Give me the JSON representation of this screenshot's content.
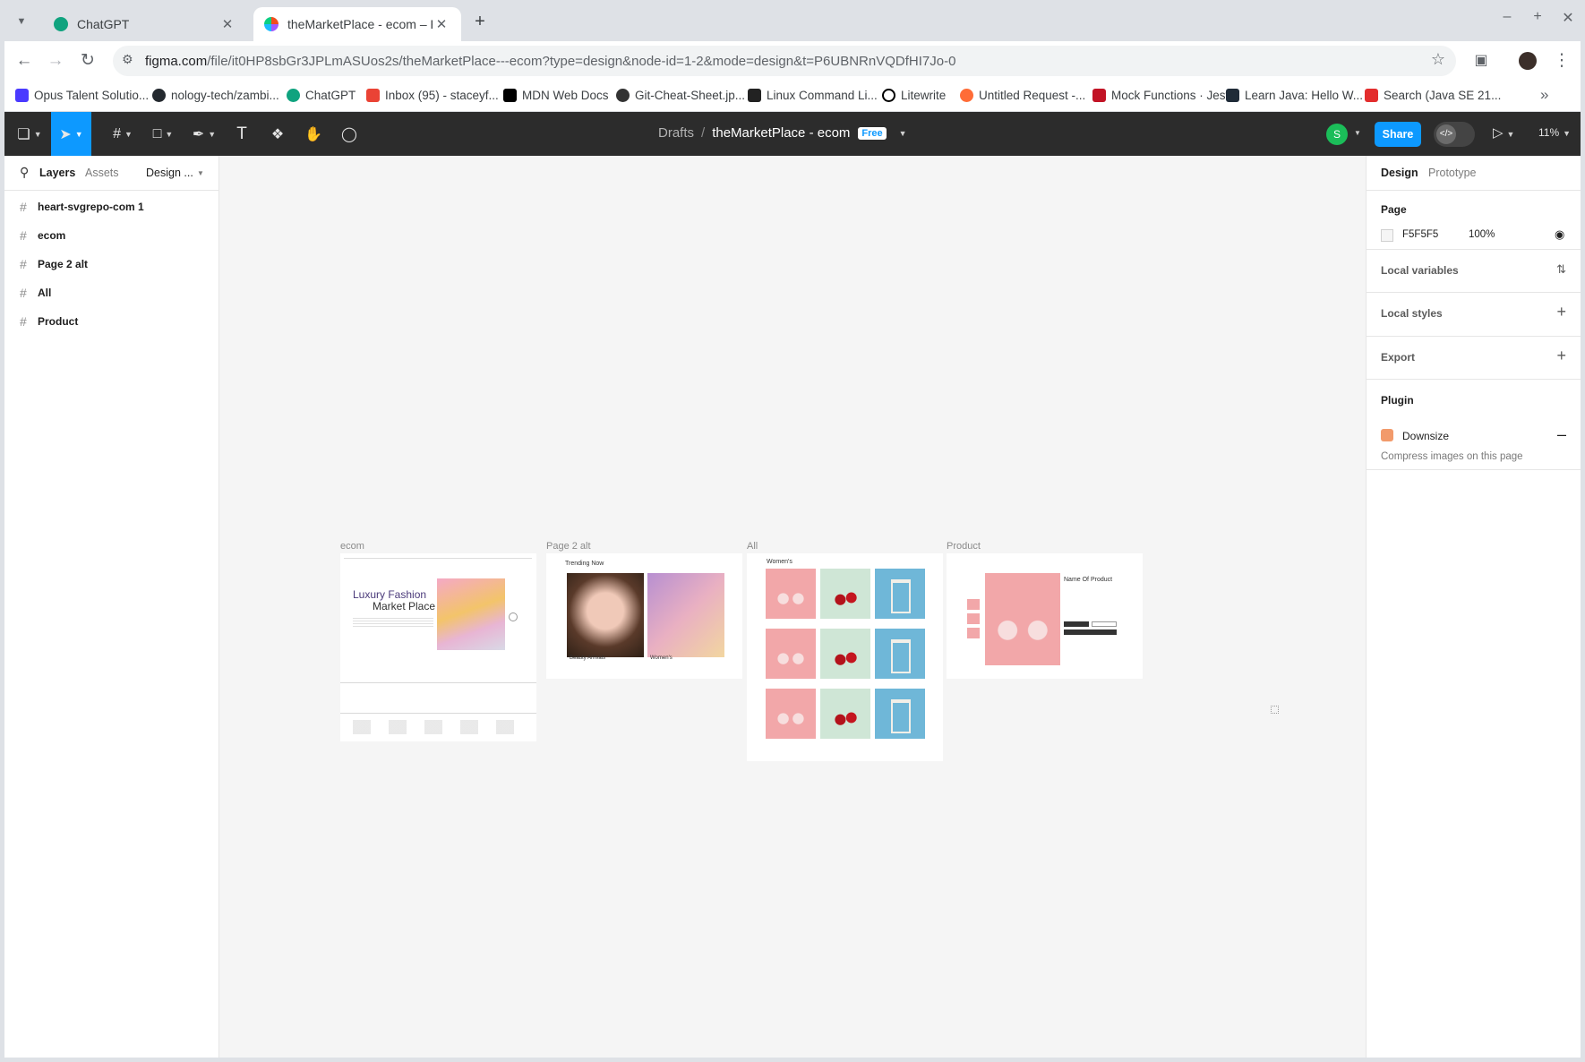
{
  "browser": {
    "tabs": [
      {
        "title": "ChatGPT",
        "active": false
      },
      {
        "title": "theMarketPlace - ecom – Figma",
        "active": true
      }
    ],
    "url_host": "figma.com",
    "url_path": "/file/it0HP8sbGr3JPLmASUos2s/theMarketPlace---ecom?type=design&node-id=1-2&mode=design&t=P6UBNRnVQDfHI7Jo-0",
    "bookmarks": [
      {
        "label": "Opus Talent Solutio...",
        "icon": "opus-icon",
        "color": "#4a3aff"
      },
      {
        "label": "nology-tech/zambi...",
        "icon": "github-icon",
        "color": "#24292f"
      },
      {
        "label": "ChatGPT",
        "icon": "chatgpt-icon",
        "color": "#10a37f"
      },
      {
        "label": "Inbox (95) - staceyf...",
        "icon": "gmail-icon",
        "color": "#ea4335"
      },
      {
        "label": "MDN Web Docs",
        "icon": "mdn-icon",
        "color": "#000000"
      },
      {
        "label": "Git-Cheat-Sheet.jp...",
        "icon": "git-icon",
        "color": "#333333"
      },
      {
        "label": "Linux Command Li...",
        "icon": "linux-icon",
        "color": "#222222"
      },
      {
        "label": "Litewrite",
        "icon": "litewrite-icon",
        "color": "#000000"
      },
      {
        "label": "Untitled Request -...",
        "icon": "postman-icon",
        "color": "#ff6c37"
      },
      {
        "label": "Mock Functions · Jest",
        "icon": "jest-icon",
        "color": "#c21325"
      },
      {
        "label": "Learn Java: Hello W...",
        "icon": "codecademy-icon",
        "color": "#1f2b38"
      },
      {
        "label": "Search (Java SE 21...",
        "icon": "oracle-icon",
        "color": "#e32d2d"
      }
    ]
  },
  "figma": {
    "breadcrumb_root": "Drafts",
    "breadcrumb_sep": "/",
    "file_name": "theMarketPlace - ecom",
    "plan_badge": "Free",
    "avatar_initial": "S",
    "share_label": "Share",
    "zoom": "11%",
    "left_tabs": [
      "Layers",
      "Assets",
      "Design ..."
    ],
    "layers": [
      "heart-svgrepo-com 1",
      "ecom",
      "Page 2 alt",
      "All",
      "Product"
    ],
    "right_tabs": [
      "Design",
      "Prototype"
    ],
    "page_section_title": "Page",
    "page_color_hex": "F5F5F5",
    "page_opacity": "100%",
    "local_variables": "Local variables",
    "local_styles": "Local styles",
    "export_label": "Export",
    "plugin_title": "Plugin",
    "plugin_name": "Downsize",
    "plugin_desc": "Compress images on this page",
    "help": "?"
  },
  "canvas": {
    "frames": [
      {
        "label": "ecom",
        "hero_title_1": "Luxury Fashion",
        "hero_title_2": "Market Place"
      },
      {
        "label": "Page 2 alt",
        "heading": "Trending Now",
        "cap1": "Beauty Arrivals",
        "cap2": "Women's"
      },
      {
        "label": "All",
        "heading": "Women's"
      },
      {
        "label": "Product",
        "heading": "Name Of Product"
      }
    ]
  },
  "colors": {
    "figma_blue": "#0d99ff",
    "toolbar_dark": "#2c2c2c",
    "canvas_bg": "#F5F5F5",
    "pink": "#f2a7a9",
    "mint": "#cfe6d6",
    "sky": "#6fb7d8"
  }
}
